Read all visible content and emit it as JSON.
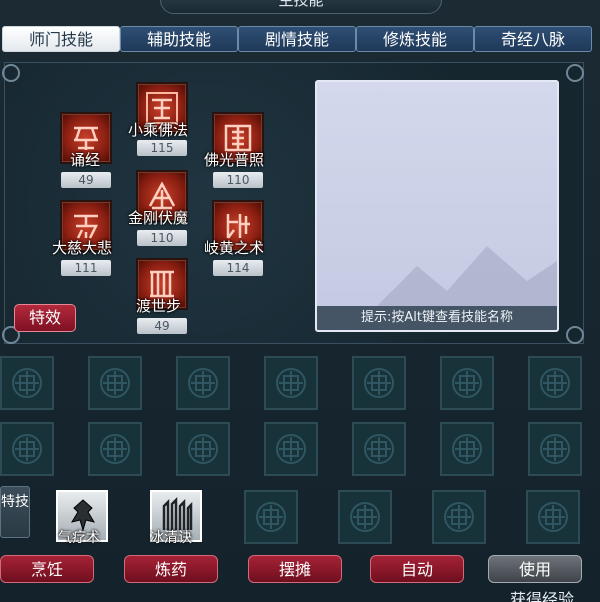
{
  "window": {
    "title": "主技能"
  },
  "tabs": [
    {
      "label": "师门技能",
      "active": true
    },
    {
      "label": "辅助技能",
      "active": false
    },
    {
      "label": "剧情技能",
      "active": false
    },
    {
      "label": "修炼技能",
      "active": false
    },
    {
      "label": "奇经八脉",
      "active": false
    }
  ],
  "skills": [
    {
      "name": "小乘佛法",
      "level": "115",
      "glyph": "seal-icon"
    },
    {
      "name": "诵经",
      "level": "49",
      "glyph": "seal-icon"
    },
    {
      "name": "佛光普照",
      "level": "110",
      "glyph": "seal-icon"
    },
    {
      "name": "金刚伏魔",
      "level": "110",
      "glyph": "seal-icon"
    },
    {
      "name": "大慈大悲",
      "level": "111",
      "glyph": "seal-icon"
    },
    {
      "name": "岐黄之术",
      "level": "114",
      "glyph": "seal-icon"
    },
    {
      "name": "渡世步",
      "level": "49",
      "glyph": "seal-icon"
    }
  ],
  "effects_button": {
    "label": "特效"
  },
  "description": {
    "hint": "提示:按Alt键查看技能名称"
  },
  "special": {
    "tag": "特技",
    "skills": [
      {
        "name": "气疗术"
      },
      {
        "name": "冰清诀"
      }
    ]
  },
  "buttons": {
    "cook": "烹饪",
    "alchemy": "炼药",
    "stall": "摆摊",
    "auto": "自动",
    "use": "使用"
  },
  "footer_text": "获得经验",
  "colors": {
    "accent_red": "#a62236",
    "tab_blue": "#2e4f74",
    "panel_dark": "#16262f"
  }
}
